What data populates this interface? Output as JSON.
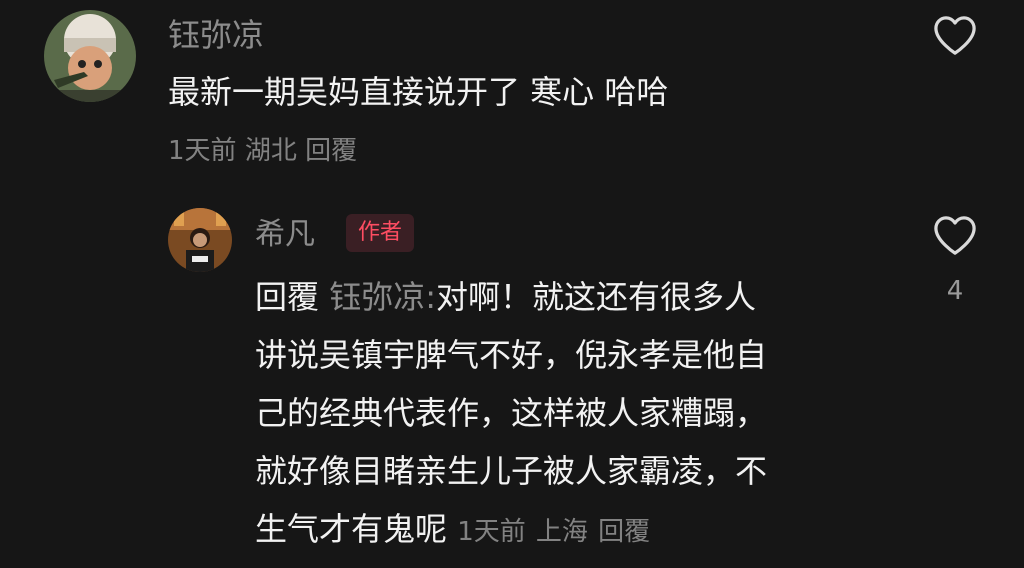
{
  "comment": {
    "username": "钰弥凉",
    "text": "最新一期吴妈直接说开了 寒心 哈哈",
    "time": "1天前",
    "location": "湖北",
    "reply_label": "回覆",
    "like_icon": "heart-outline-icon"
  },
  "reply": {
    "username": "希凡",
    "author_badge": "作者",
    "reply_prefix": "回覆",
    "reply_to": "钰弥凉:",
    "lines": [
      "对啊！就这还有很多人",
      "讲说吴镇宇脾气不好，倪永孝是他自",
      "己的经典代表作，这样被人家糟蹋，",
      "就好像目睹亲生儿子被人家霸凌，不",
      "生气才有鬼呢"
    ],
    "time": "1天前",
    "location": "上海",
    "reply_label": "回覆",
    "like_count": "4",
    "like_icon": "heart-outline-icon"
  },
  "colors": {
    "background": "#161616",
    "username": "#8c8c8c",
    "text": "#f2f2f2",
    "meta": "#828282",
    "badge_bg": "#3a1f24",
    "badge_text": "#ff4d62"
  }
}
